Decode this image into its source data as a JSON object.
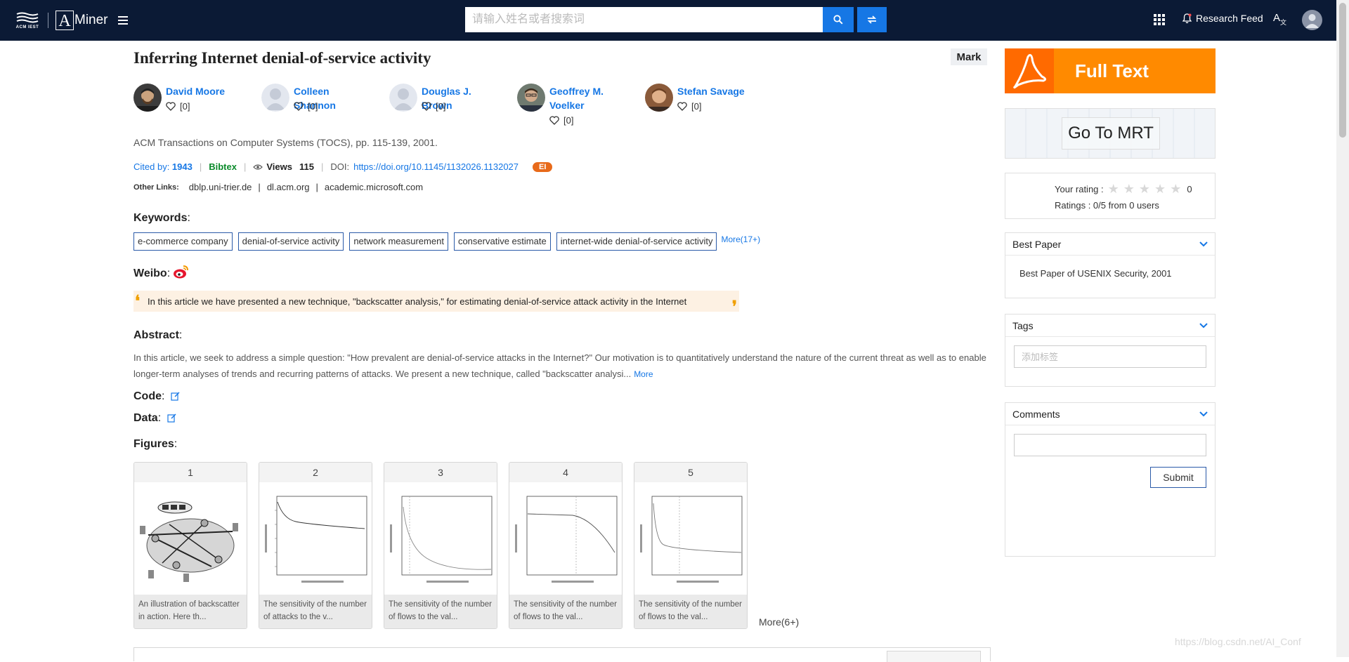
{
  "header": {
    "acm_logo_text": "ACM IEST",
    "aminer_logo_letter": "A",
    "aminer_logo_text": "Miner",
    "search_placeholder": "请输入姓名或者搜索词",
    "research_feed_label": "Research Feed",
    "colors": {
      "background": "#0b1a35",
      "accent": "#1677e5"
    }
  },
  "paper": {
    "title": "Inferring Internet denial-of-service activity",
    "mark_label": "Mark",
    "authors": [
      {
        "name": "David Moore",
        "likes": "[0]",
        "has_photo": true
      },
      {
        "name": "Colleen Shannon",
        "likes": "[0]",
        "has_photo": false
      },
      {
        "name": "Douglas J. Brown",
        "likes": "[0]",
        "has_photo": false
      },
      {
        "name": "Geoffrey M. Voelker",
        "likes": "[0]",
        "has_photo": true
      },
      {
        "name": "Stefan Savage",
        "likes": "[0]",
        "has_photo": true
      }
    ],
    "venue": "ACM Transactions on Computer Systems (TOCS), pp. 115-139, 2001.",
    "cited_by_label": "Cited by: ",
    "cited_by_count": "1943",
    "bibtex_label": "Bibtex",
    "views_label": "Views",
    "views_count": "115",
    "doi_label": "DOI:",
    "doi_value": "https://doi.org/10.1145/1132026.1132027",
    "index_badge": "EI",
    "other_links_label": "Other Links:",
    "other_links": [
      "dblp.uni-trier.de",
      "dl.acm.org",
      "academic.microsoft.com"
    ],
    "keywords_label": "Keywords",
    "keywords": [
      "e-commerce company",
      "denial-of-service activity",
      "network measurement",
      "conservative estimate",
      "internet-wide denial-of-service activity"
    ],
    "keywords_more": "More(17+)",
    "weibo_label": "Weibo",
    "weibo_text": "In this article we have presented a new technique, \"backscatter analysis,\" for estimating denial-of-service attack activity in the Internet",
    "abstract_label": "Abstract",
    "abstract_text": "In this article, we seek to address a simple question: \"How prevalent are denial-of-service attacks in the Internet?\" Our motivation is to quantitatively understand the nature of the current threat as well as to enable longer-term analyses of trends and recurring patterns of attacks. We present a new technique, called \"backscatter analysi...",
    "abstract_more": "More",
    "code_label": "Code",
    "data_label": "Data",
    "figures_label": "Figures",
    "figures": [
      {
        "num": "1",
        "caption": "An illustration of backscatter in action. Here th..."
      },
      {
        "num": "2",
        "caption": "The sensitivity of the number of attacks to the v..."
      },
      {
        "num": "3",
        "caption": "The sensitivity of the number of flows to the val..."
      },
      {
        "num": "4",
        "caption": "The sensitivity of the number of flows to the val..."
      },
      {
        "num": "5",
        "caption": "The sensitivity of the number of flows to the val..."
      }
    ],
    "figures_more": "More(6+)"
  },
  "sidebar": {
    "full_text_label": "Full Text",
    "mrt_label": "Go To MRT",
    "your_rating_label": "Your rating :",
    "your_rating_value": "0",
    "ratings_summary": "Ratings : 0/5 from 0 users",
    "best_paper_title": "Best Paper",
    "best_paper_text": "Best Paper of USENIX Security, 2001",
    "tags_title": "Tags",
    "tags_placeholder": "添加标签",
    "comments_title": "Comments",
    "submit_label": "Submit"
  },
  "watermark": "https://blog.csdn.net/AI_Conf"
}
